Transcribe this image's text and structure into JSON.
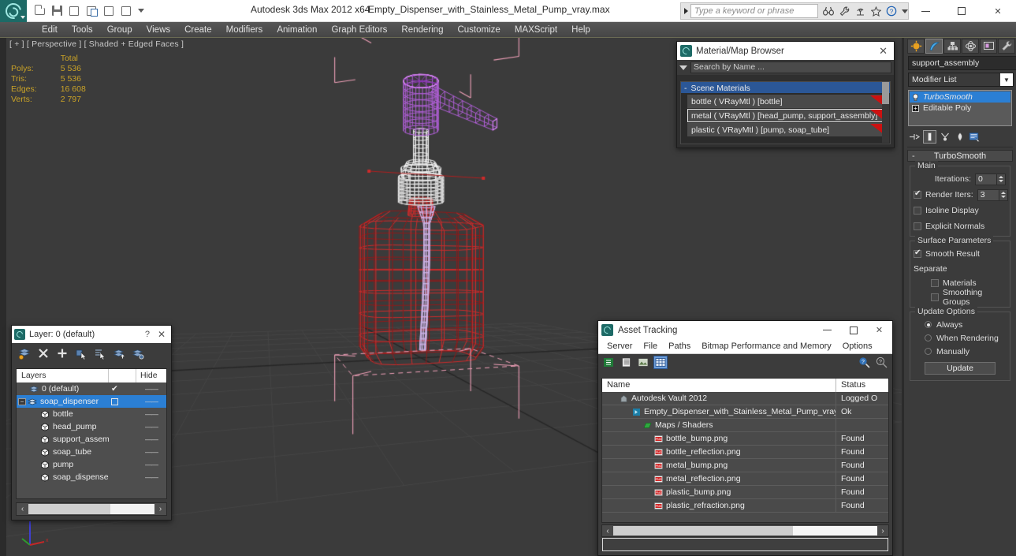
{
  "titlebar": {
    "app_title": "Autodesk 3ds Max  2012 x64",
    "file_name": "Empty_Dispenser_with_Stainless_Metal_Pump_vray.max",
    "search_placeholder": "Type a keyword or phrase",
    "quick_access": [
      {
        "name": "open-file-icon",
        "label": "Open File"
      },
      {
        "name": "save-file-icon",
        "label": "Save File"
      },
      {
        "name": "new-scene-icon",
        "label": "New Scene"
      },
      {
        "name": "new-from-template-icon",
        "label": "New From Template"
      },
      {
        "name": "undo-icon",
        "label": "Undo"
      },
      {
        "name": "redo-icon",
        "label": "Redo"
      }
    ],
    "help_icons": [
      "binoculars-icon",
      "wrench-icon",
      "satellite-icon",
      "star-icon",
      "help-circle-icon"
    ],
    "window_buttons": [
      "minimize",
      "maximize",
      "close"
    ]
  },
  "menubar": {
    "items": [
      "Edit",
      "Tools",
      "Group",
      "Views",
      "Create",
      "Modifiers",
      "Animation",
      "Graph Editors",
      "Rendering",
      "Customize",
      "MAXScript",
      "Help"
    ]
  },
  "viewport": {
    "label": "[ + ] [ Perspective ] [ Shaded + Edged Faces ]",
    "stats": {
      "column_header": "Total",
      "rows": [
        {
          "label": "Polys:",
          "value": "5 536"
        },
        {
          "label": "Tris:",
          "value": "5 536"
        },
        {
          "label": "Edges:",
          "value": "16 608"
        },
        {
          "label": "Verts:",
          "value": "2 797"
        }
      ]
    },
    "colors": {
      "background": "#3b3b3b",
      "selected_wire": "#cf2b2b",
      "pump_wire": "#b15fd8",
      "metal_wire": "#f2f2f2",
      "gizmo_pink": "#f0a0b8"
    }
  },
  "material_browser": {
    "title": "Material/Map Browser",
    "search_placeholder": "Search by Name ...",
    "group_label": "Scene Materials",
    "group_collapse": "-",
    "materials": [
      {
        "text": "bottle  ( VRayMtl )  [bottle]",
        "selected": false
      },
      {
        "text": "metal  ( VRayMtl )  [head_pump, support_assembly]",
        "selected": true
      },
      {
        "text": "plastic  ( VRayMtl )  [pump, soap_tube]",
        "selected": false
      }
    ]
  },
  "layer_dialog": {
    "title": "Layer: 0 (default)",
    "help_glyph": "?",
    "close_glyph": "✕",
    "toolbar": [
      {
        "name": "create-new-layer-icon"
      },
      {
        "name": "delete-layer-icon"
      },
      {
        "name": "add-selection-to-layer-icon"
      },
      {
        "name": "select-objects-in-layer-icon"
      },
      {
        "name": "select-highlighted-objects-icon"
      },
      {
        "name": "highlight-selected-objects-icon"
      },
      {
        "name": "hide-unhide-layer-icon"
      }
    ],
    "columns": [
      "Layers",
      "Hide"
    ],
    "rows": [
      {
        "name": "0 (default)",
        "type": "layer",
        "indent": 1,
        "selected": false,
        "check": "✔",
        "hide": "——",
        "expander": false
      },
      {
        "name": "soap_dispenser",
        "type": "layer",
        "indent": 0,
        "selected": true,
        "check": "box",
        "hide": "——",
        "expander": true
      },
      {
        "name": "bottle",
        "type": "object",
        "indent": 2,
        "selected": false,
        "check": "",
        "hide": "——",
        "expander": false
      },
      {
        "name": "head_pump",
        "type": "object",
        "indent": 2,
        "selected": false,
        "check": "",
        "hide": "——",
        "expander": false
      },
      {
        "name": "support_assembly",
        "type": "object",
        "indent": 2,
        "selected": false,
        "check": "",
        "hide": "——",
        "expander": false
      },
      {
        "name": "soap_tube",
        "type": "object",
        "indent": 2,
        "selected": false,
        "check": "",
        "hide": "——",
        "expander": false
      },
      {
        "name": "pump",
        "type": "object",
        "indent": 2,
        "selected": false,
        "check": "",
        "hide": "——",
        "expander": false
      },
      {
        "name": "soap_dispenser",
        "type": "object",
        "indent": 2,
        "selected": false,
        "check": "",
        "hide": "——",
        "expander": false
      }
    ]
  },
  "asset_tracking": {
    "title": "Asset Tracking",
    "menu": [
      "Server",
      "File",
      "Paths",
      "Bitmap Performance and Memory",
      "Options"
    ],
    "toolbar": [
      {
        "name": "refresh-assets-icon",
        "active": false
      },
      {
        "name": "list-view-icon",
        "active": false
      },
      {
        "name": "thumbnail-view-icon",
        "active": false
      },
      {
        "name": "grid-view-icon",
        "active": true
      },
      {
        "name": "help-search-icon",
        "active": false
      },
      {
        "name": "help-icon",
        "active": false
      }
    ],
    "columns": [
      "Name",
      "Status"
    ],
    "rows": [
      {
        "name": "Autodesk Vault 2012",
        "status": "Logged O",
        "indent": 0,
        "icon": "vault-icon"
      },
      {
        "name": "Empty_Dispenser_with_Stainless_Metal_Pump_vray.max",
        "status": "Ok",
        "indent": 1,
        "icon": "max-file-icon"
      },
      {
        "name": "Maps / Shaders",
        "status": "",
        "indent": 2,
        "icon": "maps-folder-icon"
      },
      {
        "name": "bottle_bump.png",
        "status": "Found",
        "indent": 3,
        "icon": "png-icon"
      },
      {
        "name": "bottle_reflection.png",
        "status": "Found",
        "indent": 3,
        "icon": "png-icon"
      },
      {
        "name": "metal_bump.png",
        "status": "Found",
        "indent": 3,
        "icon": "png-icon"
      },
      {
        "name": "metal_reflection.png",
        "status": "Found",
        "indent": 3,
        "icon": "png-icon"
      },
      {
        "name": "plastic_bump.png",
        "status": "Found",
        "indent": 3,
        "icon": "png-icon"
      },
      {
        "name": "plastic_refraction.png",
        "status": "Found",
        "indent": 3,
        "icon": "png-icon"
      }
    ],
    "status_bar_text": ""
  },
  "command_panel": {
    "tabs": [
      {
        "name": "create-tab",
        "active": false
      },
      {
        "name": "modify-tab",
        "active": true
      },
      {
        "name": "hierarchy-tab",
        "active": false
      },
      {
        "name": "motion-tab",
        "active": false
      },
      {
        "name": "display-tab",
        "active": false
      },
      {
        "name": "utilities-tab",
        "active": false
      }
    ],
    "object_name": "support_assembly",
    "object_color": "#d79ae0",
    "modifier_list_label": "Modifier List",
    "stack": [
      {
        "label": "TurboSmooth",
        "selected": true,
        "expandable": false
      },
      {
        "label": "Editable Poly",
        "selected": false,
        "expandable": true
      }
    ],
    "stack_tools": [
      {
        "name": "pin-stack-icon"
      },
      {
        "name": "show-end-result-icon",
        "active": true
      },
      {
        "name": "make-unique-icon"
      },
      {
        "name": "remove-modifier-icon"
      },
      {
        "name": "configure-modifier-sets-icon"
      }
    ],
    "rollout": {
      "title": "TurboSmooth",
      "collapse_glyph": "-",
      "main": {
        "caption": "Main",
        "iterations_label": "Iterations:",
        "iterations_value": "0",
        "render_iters_label": "Render Iters:",
        "render_iters_value": "3",
        "render_iters_checked": true,
        "isoline_display_label": "Isoline Display",
        "isoline_display_checked": false,
        "explicit_normals_label": "Explicit Normals",
        "explicit_normals_checked": false
      },
      "surface": {
        "caption": "Surface Parameters",
        "smooth_result_label": "Smooth Result",
        "smooth_result_checked": true,
        "separate_label": "Separate",
        "materials_label": "Materials",
        "materials_checked": false,
        "smoothing_groups_label": "Smoothing Groups",
        "smoothing_groups_checked": false
      },
      "update": {
        "caption": "Update Options",
        "options": [
          {
            "label": "Always",
            "selected": true
          },
          {
            "label": "When Rendering",
            "selected": false
          },
          {
            "label": "Manually",
            "selected": false
          }
        ],
        "button_label": "Update"
      }
    }
  }
}
